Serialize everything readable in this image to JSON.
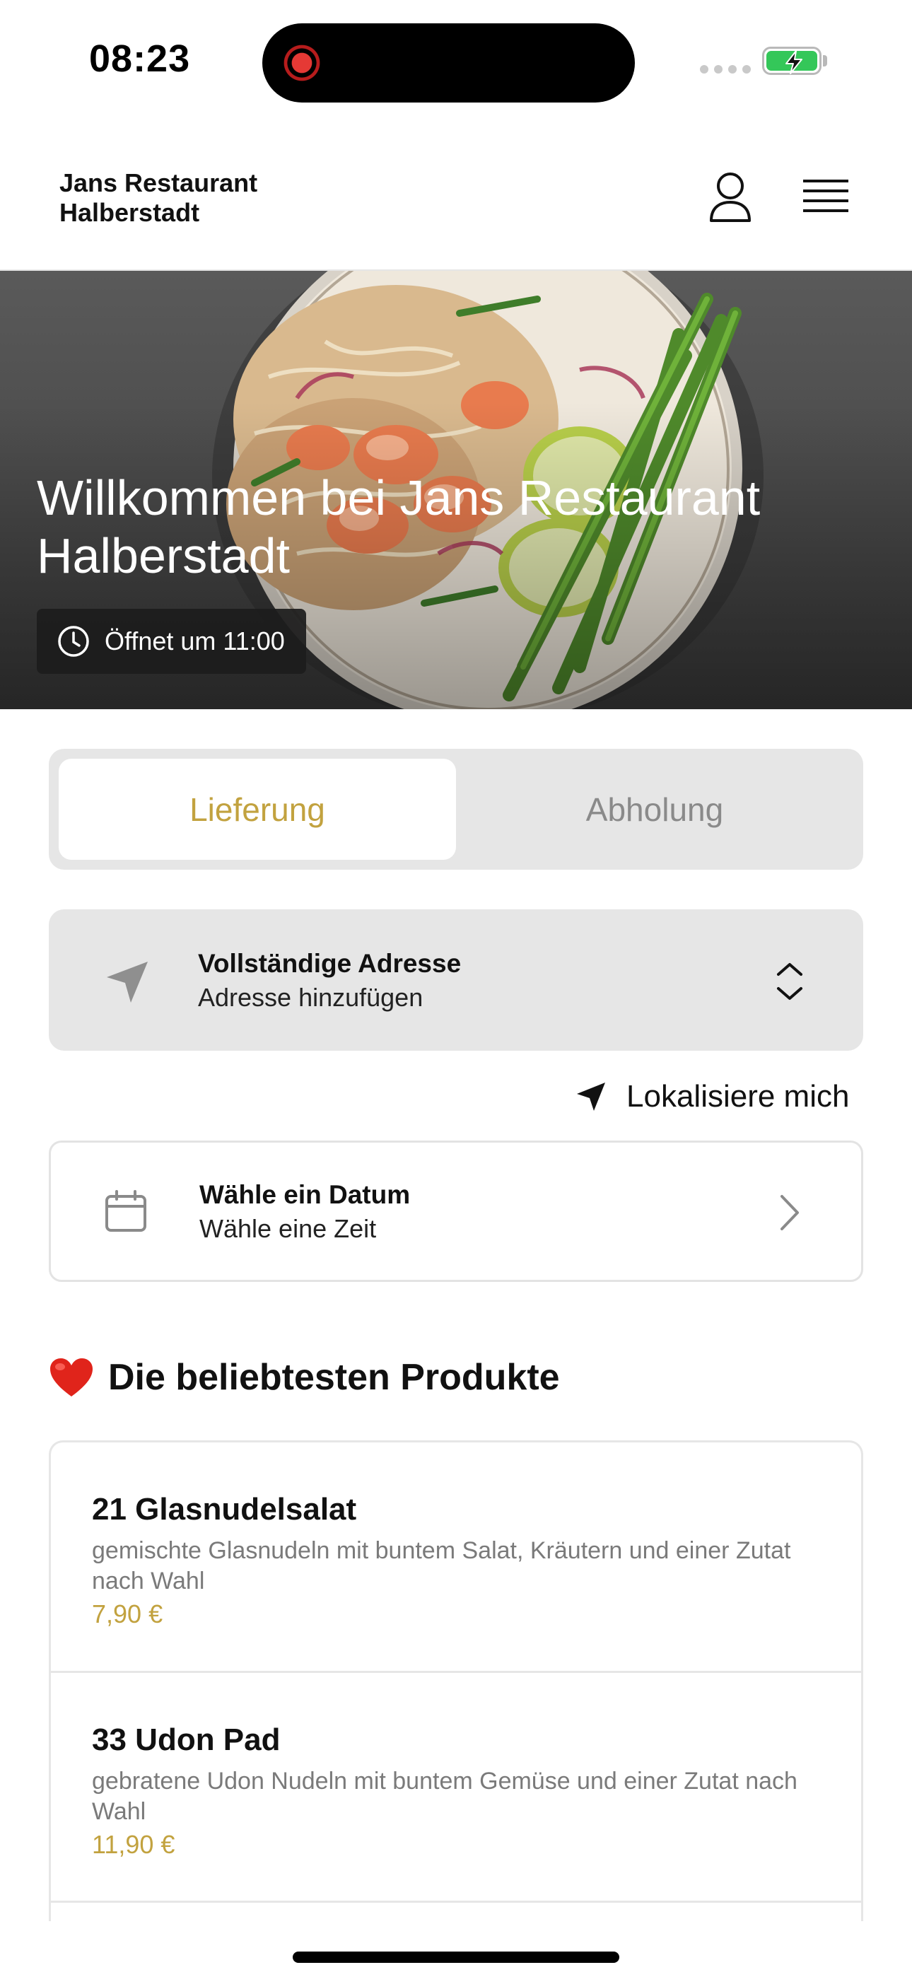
{
  "status_bar": {
    "time": "08:23"
  },
  "header": {
    "title": "Jans Restaurant Halberstadt",
    "icons": [
      "user-icon",
      "menu-icon"
    ]
  },
  "hero": {
    "title": "Willkommen bei Jans Restaurant Halberstadt",
    "hours": "Öffnet um 11:00"
  },
  "order_mode": {
    "options": [
      "Lieferung",
      "Abholung"
    ],
    "selected": "Lieferung",
    "accent_color": "#c2a23f"
  },
  "address": {
    "title": "Vollständige Adresse",
    "subtitle": "Adresse hinzufügen"
  },
  "locate_me": "Lokalisiere mich",
  "schedule": {
    "title": "Wähle ein Datum",
    "subtitle": "Wähle eine Zeit"
  },
  "popular": {
    "heading": "Die beliebtesten Produkte",
    "emoji": "❤️",
    "products": [
      {
        "name": "21 Glasnudelsalat",
        "description": "gemischte Glasnudeln mit buntem Salat, Kräutern und einer Zutat nach Wahl",
        "price": "7,90 €"
      },
      {
        "name": "33 Udon Pad",
        "description": "gebratene Udon Nudeln mit buntem Gemüse und einer Zutat nach Wahl",
        "price": "11,90 €"
      }
    ]
  }
}
